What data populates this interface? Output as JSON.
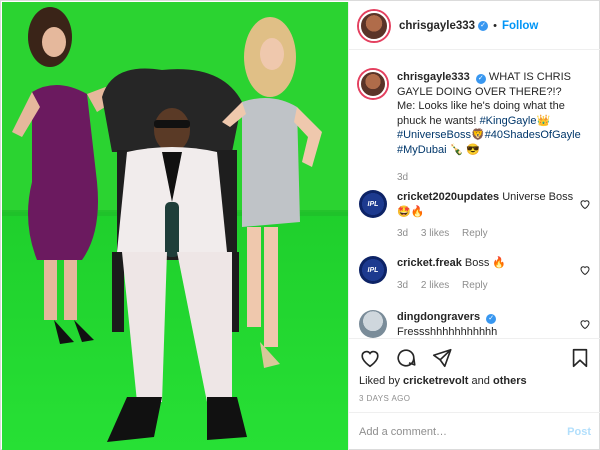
{
  "header": {
    "username": "chrisgayle333",
    "separator": "•",
    "follow_label": "Follow"
  },
  "caption": {
    "username": "chrisgayle333",
    "text_line1": "WHAT IS CHRIS GAYLE DOING OVER THERE?!?",
    "text_line2": "Me: Looks like he's doing what the phuck he wants!",
    "tags": [
      "#KingGayle",
      "👑",
      "#UniverseBoss",
      "🦁",
      "#40ShadesOfGayle",
      "#MyDubai",
      "🍾",
      "😎"
    ],
    "time": "3d"
  },
  "comments": [
    {
      "username": "cricket2020updates",
      "text": "Universe Boss 🤩🔥",
      "time": "3d",
      "likes": "3 likes",
      "reply": "Reply",
      "avatar_text": "IPL"
    },
    {
      "username": "cricket.freak",
      "text": "Boss 🔥",
      "time": "3d",
      "likes": "2 likes",
      "reply": "Reply",
      "avatar_text": "IPL"
    },
    {
      "username": "dingdongravers",
      "text": "Fressshhhhhhhhhhh",
      "verified": true
    }
  ],
  "likes": {
    "prefix": "Liked by",
    "user": "cricketrevolt",
    "joiner": "and",
    "others": "others"
  },
  "posted": "3 DAYS AGO",
  "add_comment": {
    "placeholder": "Add a comment…",
    "post_label": "Post"
  },
  "colors": {
    "green_screen": "#2bd331",
    "follow_blue": "#0095f6",
    "hashtag": "#00376b"
  }
}
